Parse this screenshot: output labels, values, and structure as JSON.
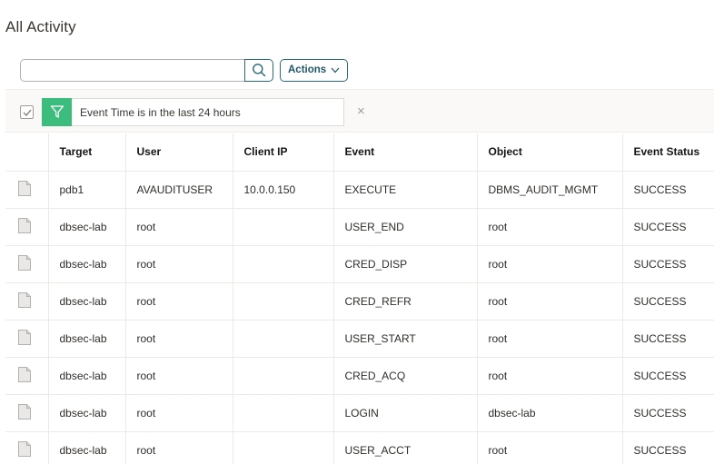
{
  "page": {
    "title": "All Activity"
  },
  "search": {
    "placeholder": "",
    "value": ""
  },
  "toolbar": {
    "actions_label": "Actions"
  },
  "filter": {
    "label": "Event Time is in the last 24 hours",
    "checked": true
  },
  "table": {
    "columns": [
      "",
      "Target",
      "User",
      "Client IP",
      "Event",
      "Object",
      "Event Status"
    ],
    "rows": [
      {
        "target": "pdb1",
        "user": "AVAUDITUSER",
        "client_ip": "10.0.0.150",
        "event": "EXECUTE",
        "object": "DBMS_AUDIT_MGMT",
        "status": "SUCCESS"
      },
      {
        "target": "dbsec-lab",
        "user": "root",
        "client_ip": "",
        "event": "USER_END",
        "object": "root",
        "status": "SUCCESS"
      },
      {
        "target": "dbsec-lab",
        "user": "root",
        "client_ip": "",
        "event": "CRED_DISP",
        "object": "root",
        "status": "SUCCESS"
      },
      {
        "target": "dbsec-lab",
        "user": "root",
        "client_ip": "",
        "event": "CRED_REFR",
        "object": "root",
        "status": "SUCCESS"
      },
      {
        "target": "dbsec-lab",
        "user": "root",
        "client_ip": "",
        "event": "USER_START",
        "object": "root",
        "status": "SUCCESS"
      },
      {
        "target": "dbsec-lab",
        "user": "root",
        "client_ip": "",
        "event": "CRED_ACQ",
        "object": "root",
        "status": "SUCCESS"
      },
      {
        "target": "dbsec-lab",
        "user": "root",
        "client_ip": "",
        "event": "LOGIN",
        "object": "dbsec-lab",
        "status": "SUCCESS"
      },
      {
        "target": "dbsec-lab",
        "user": "root",
        "client_ip": "",
        "event": "USER_ACCT",
        "object": "root",
        "status": "SUCCESS"
      }
    ]
  },
  "colors": {
    "accent": "#2a6a7c",
    "filter_chip": "#3dbd7d"
  },
  "icons": {
    "search": "search-icon",
    "actions": "chevron-down-icon",
    "filter": "filter-icon",
    "remove": "close-icon",
    "row": "document-icon",
    "check": "checkmark-icon"
  }
}
